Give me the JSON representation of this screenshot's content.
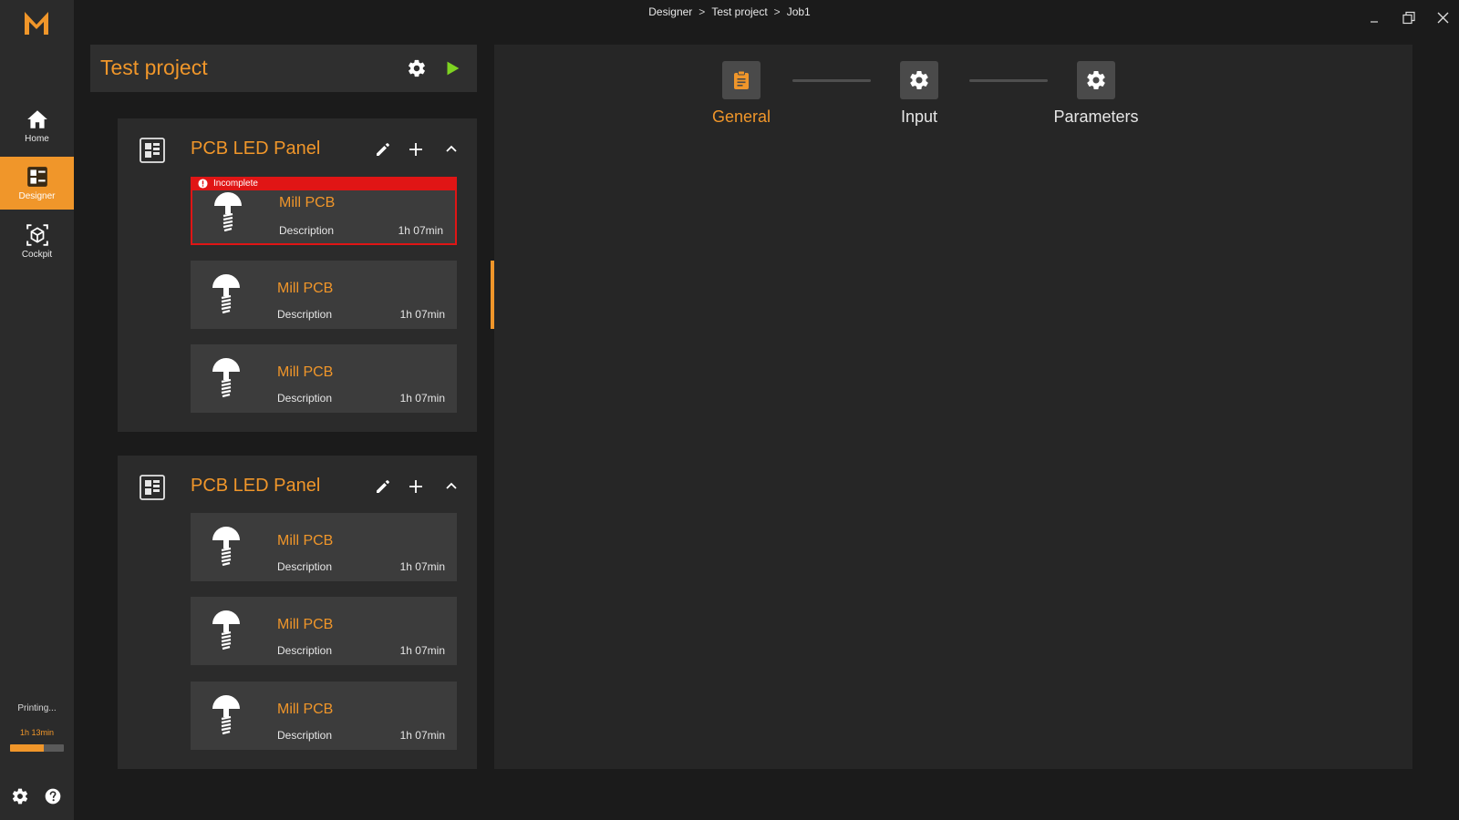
{
  "breadcrumb": {
    "items": [
      "Designer",
      "Test project",
      "Job1"
    ],
    "separator": ">"
  },
  "sidebar": {
    "logo_text": "M",
    "items": [
      {
        "label": "Home",
        "icon": "home-icon"
      },
      {
        "label": "Designer",
        "icon": "designer-icon",
        "active": true
      },
      {
        "label": "Cockpit",
        "icon": "cockpit-icon"
      }
    ],
    "print_status": "Printing...",
    "print_time": "1h 13min",
    "print_progress": 0.62,
    "bottom_icons": [
      "gear-icon",
      "help-icon"
    ]
  },
  "project": {
    "title": "Test project",
    "icons": [
      "gear-icon",
      "play-icon"
    ]
  },
  "groups": [
    {
      "title": "PCB LED Panel",
      "jobs": [
        {
          "title": "Mill PCB",
          "description": "Description",
          "time": "1h 07min",
          "status": "Incomplete"
        },
        {
          "title": "Mill PCB",
          "description": "Description",
          "time": "1h 07min",
          "selected": true
        },
        {
          "title": "Mill PCB",
          "description": "Description",
          "time": "1h 07min"
        }
      ]
    },
    {
      "title": "PCB LED Panel",
      "jobs": [
        {
          "title": "Mill PCB",
          "description": "Description",
          "time": "1h 07min"
        },
        {
          "title": "Mill PCB",
          "description": "Description",
          "time": "1h 07min"
        },
        {
          "title": "Mill PCB",
          "description": "Description",
          "time": "1h 07min"
        }
      ]
    }
  ],
  "steps": [
    {
      "label": "General",
      "icon": "clipboard-icon",
      "active": true
    },
    {
      "label": "Input",
      "icon": "gear-icon"
    },
    {
      "label": "Parameters",
      "icon": "gear-icon"
    }
  ],
  "colors": {
    "accent": "#f0962a",
    "error": "#e01515",
    "play": "#7ed321",
    "background": "#1b1b1b",
    "sidebar": "#2b2b2b"
  }
}
